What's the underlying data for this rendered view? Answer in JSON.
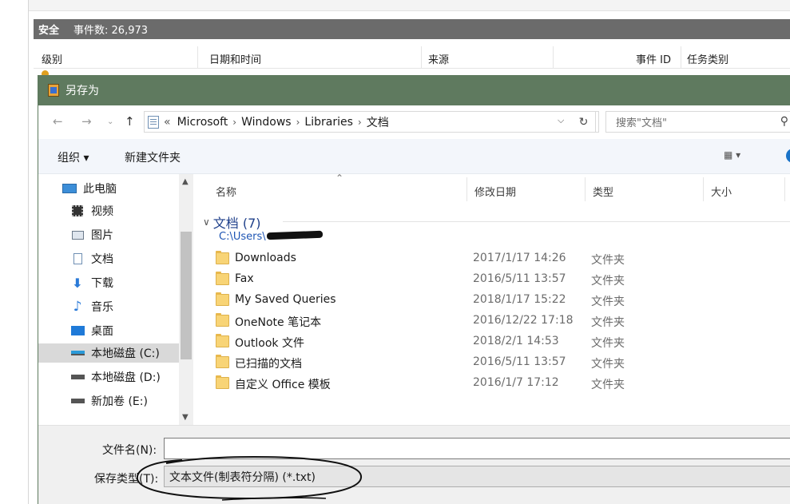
{
  "event_viewer": {
    "log_name": "安全",
    "event_count": "事件数: 26,973",
    "columns": [
      "级别",
      "日期和时间",
      "来源",
      "事件 ID",
      "任务类别"
    ]
  },
  "dialog": {
    "title": "另存为",
    "address": {
      "prefix": "«",
      "crumbs": [
        "Microsoft",
        "Windows",
        "Libraries",
        "文档"
      ],
      "search_placeholder": "搜索\"文档\""
    },
    "toolbar": {
      "organize": "组织 ▾",
      "new_folder": "新建文件夹"
    },
    "nav": {
      "items": [
        {
          "label": "此电脑",
          "icon": "computer-icon"
        },
        {
          "label": "视频",
          "icon": "video-icon"
        },
        {
          "label": "图片",
          "icon": "pictures-icon"
        },
        {
          "label": "文档",
          "icon": "documents-icon"
        },
        {
          "label": "下载",
          "icon": "download-icon"
        },
        {
          "label": "音乐",
          "icon": "music-icon"
        },
        {
          "label": "桌面",
          "icon": "desktop-icon"
        },
        {
          "label": "本地磁盘 (C:)",
          "icon": "drive-c-icon"
        },
        {
          "label": "本地磁盘 (D:)",
          "icon": "drive-icon"
        },
        {
          "label": "新加卷 (E:)",
          "icon": "drive-icon"
        }
      ]
    },
    "columns": {
      "name": "名称",
      "modified": "修改日期",
      "type": "类型",
      "size": "大小"
    },
    "group": {
      "title": "文档 (7)",
      "path": "C:\\Users\\"
    },
    "files": [
      {
        "name": "Downloads",
        "modified": "2017/1/17 14:26",
        "type": "文件夹"
      },
      {
        "name": "Fax",
        "modified": "2016/5/11 13:57",
        "type": "文件夹"
      },
      {
        "name": "My Saved Queries",
        "modified": "2018/1/17 15:22",
        "type": "文件夹"
      },
      {
        "name": "OneNote 笔记本",
        "modified": "2016/12/22 17:18",
        "type": "文件夹"
      },
      {
        "name": "Outlook 文件",
        "modified": "2018/2/1 14:53",
        "type": "文件夹"
      },
      {
        "name": "已扫描的文档",
        "modified": "2016/5/11 13:57",
        "type": "文件夹"
      },
      {
        "name": "自定义 Office 模板",
        "modified": "2016/1/7 17:12",
        "type": "文件夹"
      }
    ],
    "form": {
      "filename_label": "文件名(N):",
      "filename_value": "",
      "filetype_label": "保存类型(T):",
      "filetype_value": "文本文件(制表符分隔) (*.txt)"
    }
  }
}
